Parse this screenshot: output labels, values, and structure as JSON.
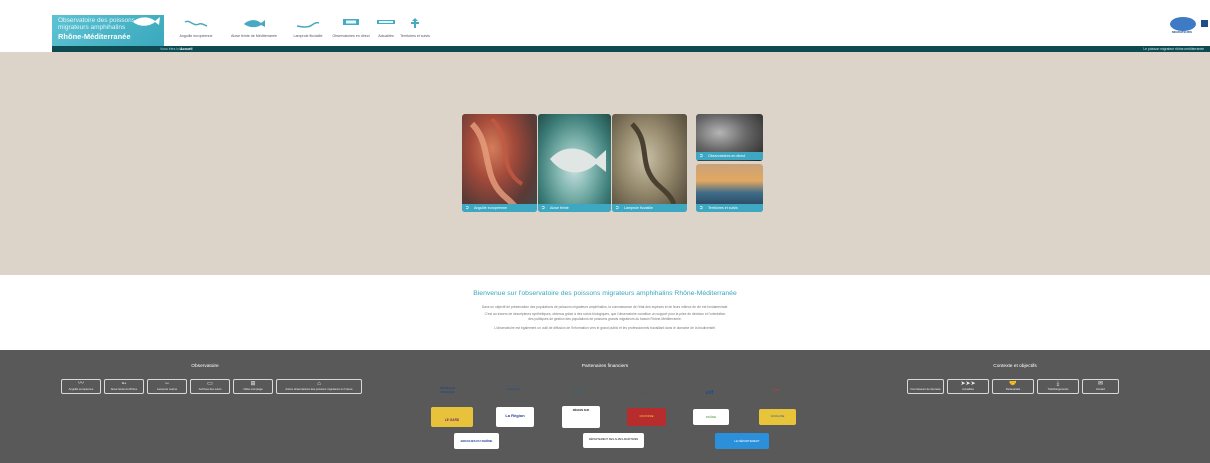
{
  "header": {
    "logo_line1": "Observatoire des poissons",
    "logo_line2": "migrateurs amphihalins",
    "logo_line3": "Rhône-Méditerranée",
    "nav": [
      {
        "label": "Anguille européenne",
        "icon": "eel-icon"
      },
      {
        "label": "Alose feinte de Méditerranée",
        "icon": "shad-icon"
      },
      {
        "label": "Lamproie fluviatile",
        "icon": "lamprey-icon"
      },
      {
        "label": "Observatoires en direct",
        "icon": "camera-icon"
      },
      {
        "label": "Actualités",
        "icon": "news-icon"
      },
      {
        "label": "Territoires et suivis",
        "icon": "territory-icon"
      }
    ],
    "partner_logo_text": "MIGRATEURS"
  },
  "breadcrumb": {
    "prefix": "Vous êtes ici :",
    "current": "Accueil",
    "right_text": "Le poisson migrateur rhône-méditerranée"
  },
  "hero": {
    "cards": [
      {
        "label": "Anguille européenne"
      },
      {
        "label": "Alose feinte"
      },
      {
        "label": "Lamproie fluviatile"
      },
      {
        "label": "Observatoires en direct"
      },
      {
        "label": "Territoires et suivis"
      }
    ]
  },
  "welcome": {
    "title": "Bienvenue sur l'observatoire des poissons migrateurs amphihalins Rhône-Méditerranée",
    "p1": "Dans un objectif de préservation des populations de poissons migrateurs amphihalins, la connaissance de l'état des espèces et de leurs milieux de vie est fondamentale.",
    "p2": "C'est au travers de descripteurs synthétiques, obtenus grâce à des suivis biologiques, que l'observatoire constitue un support pour la prise de décision et l'orientation",
    "p3": "des politiques de gestion des populations de poissons grands migrateurs du bassin Rhône-Méditerranée.",
    "p4": "L'observatoire est également un outil de diffusion de l'information vers le grand public et les professionnels travaillant dans le domaine de la biodiversité."
  },
  "footer": {
    "observatoire_title": "Observatoire",
    "observatoire_buttons": [
      {
        "label": "Anguille européenne",
        "icon": "eel-icon"
      },
      {
        "label": "Alose feinte du Rhône",
        "icon": "shad-icon"
      },
      {
        "label": "Lamproie marine",
        "icon": "lamprey-icon"
      },
      {
        "label": "Archives des suivis",
        "icon": "archive-icon"
      },
      {
        "label": "Vidéo-comptage",
        "icon": "counter-icon"
      },
      {
        "label": "Autres observatoires des poissons migrateurs en France",
        "icon": "house-icon"
      }
    ],
    "partners_title": "Partenaires financiers",
    "partners_row1": [
      {
        "text": "RÉPUBLIQUE FRANÇAISE",
        "bg": "#ffffff",
        "fg": "#1d3f8c"
      },
      {
        "text": "MIGRATEURS",
        "bg": "#ffffff",
        "fg": "#1d4d8c"
      },
      {
        "text": "AGENCE DE L'EAU",
        "bg": "#ffffff",
        "fg": "#2b6f8f"
      },
      {
        "text": "PÊCHE",
        "bg": "#ffffff",
        "fg": "#556"
      },
      {
        "text": "edf",
        "bg": "#ffffff",
        "fg": "#ff6a00"
      },
      {
        "text": "CNR",
        "bg": "#ffffff",
        "fg": "#e0303b"
      }
    ],
    "partners_row2": [
      {
        "text": "LE GARD",
        "bg": "#e9c23b",
        "fg": "#6d2a75"
      },
      {
        "text": "La Région",
        "bg": "#ffffff",
        "fg": "#1d3f8c"
      },
      {
        "text": "RÉGION SUD",
        "bg": "#ffffff",
        "fg": "#222"
      },
      {
        "text": "OCCITANIE",
        "bg": "#b72c2c",
        "fg": "#ffd43b"
      },
      {
        "text": "DRÔME",
        "bg": "#ffffff",
        "fg": "#4d8f3c"
      },
      {
        "text": "VAUCLUSE",
        "bg": "#e8c43a",
        "fg": "#2c5a9c"
      }
    ],
    "partners_row3": [
      {
        "text": "BOUCHES DU RHÔNE",
        "bg": "#ffffff",
        "fg": "#1d3f8c"
      },
      {
        "text": "DÉPARTEMENT DES ALPES-MARITIMES",
        "bg": "#ffffff",
        "fg": "#222"
      },
      {
        "text": "LE DÉPARTEMENT",
        "bg": "#2b90d9",
        "fg": "#ffffff"
      }
    ],
    "contact_title": "Contexte et objectifs",
    "contact_buttons": [
      {
        "label": "Fournisseurs de données",
        "icon": "provider-icon"
      },
      {
        "label": "Actualités",
        "icon": "arrows-icon"
      },
      {
        "label": "Partenariats",
        "icon": "handshake-icon"
      },
      {
        "label": "Téléchargements",
        "icon": "download-icon"
      },
      {
        "label": "Contact",
        "icon": "mail-icon"
      }
    ]
  }
}
